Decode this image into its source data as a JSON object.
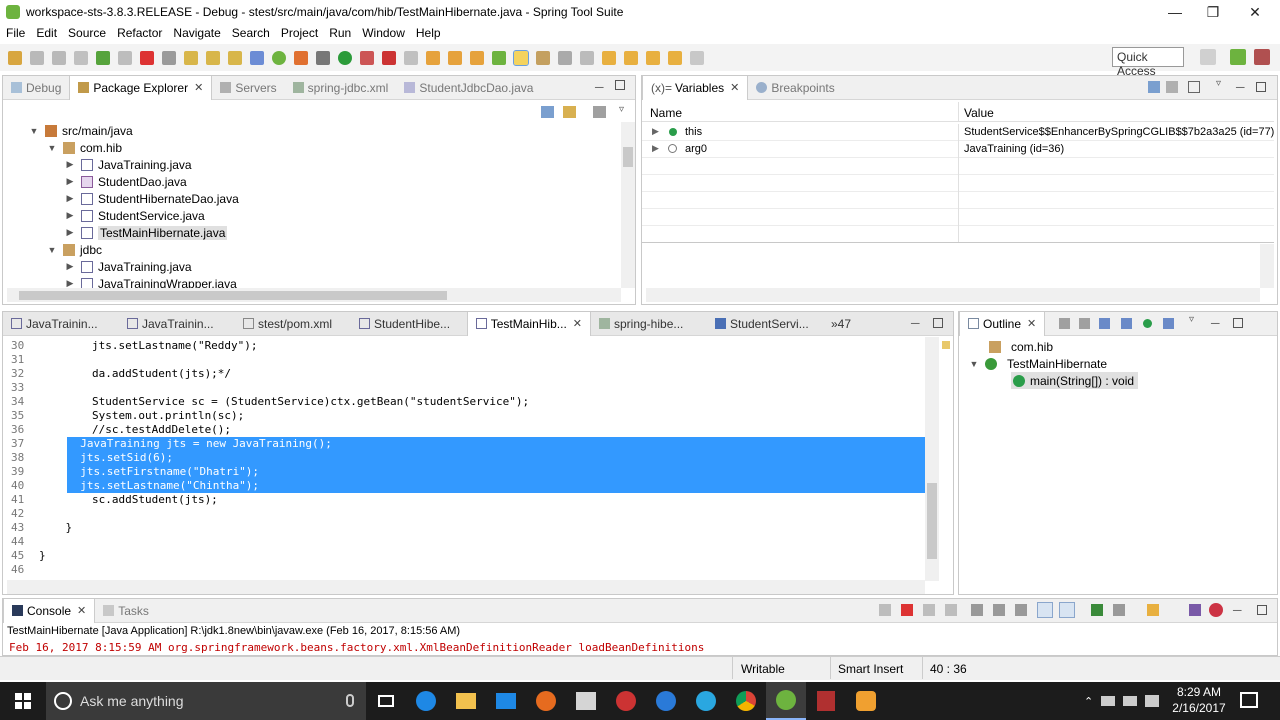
{
  "window": {
    "title": "workspace-sts-3.8.3.RELEASE - Debug - stest/src/main/java/com/hib/TestMainHibernate.java - Spring Tool Suite"
  },
  "menu": [
    "File",
    "Edit",
    "Source",
    "Refactor",
    "Navigate",
    "Search",
    "Project",
    "Run",
    "Window",
    "Help"
  ],
  "quick_access": "Quick Access",
  "left_tabs": [
    {
      "label": "Debug"
    },
    {
      "label": "Package Explorer",
      "active": true
    },
    {
      "label": "Servers"
    },
    {
      "label": "spring-jdbc.xml"
    },
    {
      "label": "StudentJdbcDao.java"
    }
  ],
  "tree": [
    {
      "label": "src/main/java",
      "depth": 1,
      "expanded": true,
      "icon": "source-folder-icon"
    },
    {
      "label": "com.hib",
      "depth": 2,
      "expanded": true,
      "icon": "package-icon"
    },
    {
      "label": "JavaTraining.java",
      "depth": 3,
      "icon": "java-file-icon"
    },
    {
      "label": "StudentDao.java",
      "depth": 3,
      "icon": "java-interface-icon"
    },
    {
      "label": "StudentHibernateDao.java",
      "depth": 3,
      "icon": "java-file-icon"
    },
    {
      "label": "StudentService.java",
      "depth": 3,
      "icon": "java-file-icon"
    },
    {
      "label": "TestMainHibernate.java",
      "depth": 3,
      "icon": "java-file-icon",
      "selected": true
    },
    {
      "label": "jdbc",
      "depth": 2,
      "expanded": true,
      "icon": "package-icon"
    },
    {
      "label": "JavaTraining.java",
      "depth": 3,
      "icon": "java-file-icon"
    },
    {
      "label": "JavaTrainingWrapper.java",
      "depth": 3,
      "icon": "java-file-icon"
    }
  ],
  "variables": {
    "tabs": [
      {
        "label": "Variables",
        "prefix": "(x)=",
        "active": true
      },
      {
        "label": "Breakpoints"
      }
    ],
    "headers": [
      "Name",
      "Value"
    ],
    "rows": [
      {
        "name": "this",
        "value": "StudentService$$EnhancerBySpringCGLIB$$7b2a3a25  (id=77)"
      },
      {
        "name": "arg0",
        "value": "JavaTraining  (id=36)"
      }
    ]
  },
  "editor_tabs": [
    {
      "label": "JavaTrainin..."
    },
    {
      "label": "JavaTrainin..."
    },
    {
      "label": "stest/pom.xml"
    },
    {
      "label": "StudentHibe..."
    },
    {
      "label": "TestMainHib...",
      "active": true
    },
    {
      "label": "spring-hibe..."
    },
    {
      "label": "StudentServi..."
    },
    {
      "label": "»47"
    }
  ],
  "code": [
    {
      "n": "30",
      "t": "        jts.setLastname(\"Reddy\");"
    },
    {
      "n": "31",
      "t": ""
    },
    {
      "n": "32",
      "t": "        da.addStudent(jts);*/"
    },
    {
      "n": "33",
      "t": ""
    },
    {
      "n": "34",
      "t": "        StudentService sc = (StudentService)ctx.getBean(\"studentService\");"
    },
    {
      "n": "35",
      "t": "        System.out.println(sc);"
    },
    {
      "n": "36",
      "t": "        //sc.testAddDelete();"
    },
    {
      "n": "37",
      "t": "        JavaTraining jts = new JavaTraining();",
      "sel": true
    },
    {
      "n": "38",
      "t": "        jts.setSid(6);",
      "sel": true
    },
    {
      "n": "39",
      "t": "        jts.setFirstname(\"Dhatri\");",
      "sel": true
    },
    {
      "n": "40",
      "t": "        jts.setLastname(\"Chintha\");",
      "sel": true
    },
    {
      "n": "41",
      "t": "        sc.addStudent(jts);"
    },
    {
      "n": "42",
      "t": ""
    },
    {
      "n": "43",
      "t": "    }"
    },
    {
      "n": "44",
      "t": ""
    },
    {
      "n": "45",
      "t": "}"
    },
    {
      "n": "46",
      "t": ""
    }
  ],
  "outline": {
    "tab": "Outline",
    "items": [
      {
        "label": "com.hib",
        "depth": 0
      },
      {
        "label": "TestMainHibernate",
        "depth": 0,
        "expanded": true
      },
      {
        "label": "main(String[]) : void",
        "depth": 1,
        "selected": true
      }
    ]
  },
  "console": {
    "tabs": [
      {
        "label": "Console",
        "active": true
      },
      {
        "label": "Tasks"
      }
    ],
    "header": "TestMainHibernate [Java Application] R:\\jdk1.8new\\bin\\javaw.exe (Feb 16, 2017, 8:15:56 AM)",
    "line": "Feb 16, 2017 8:15:59 AM org.springframework.beans.factory.xml.XmlBeanDefinitionReader loadBeanDefinitions"
  },
  "status": {
    "writable": "Writable",
    "insert": "Smart Insert",
    "position": "40 : 36"
  },
  "taskbar": {
    "search": "Ask me anything",
    "time": "8:29 AM",
    "date": "2/16/2017"
  },
  "colors": {
    "selection": "#3399ff",
    "console_error": "#c00000",
    "keyword": "#7f0055",
    "string": "#2a00ff",
    "comment": "#3f7f5f"
  }
}
